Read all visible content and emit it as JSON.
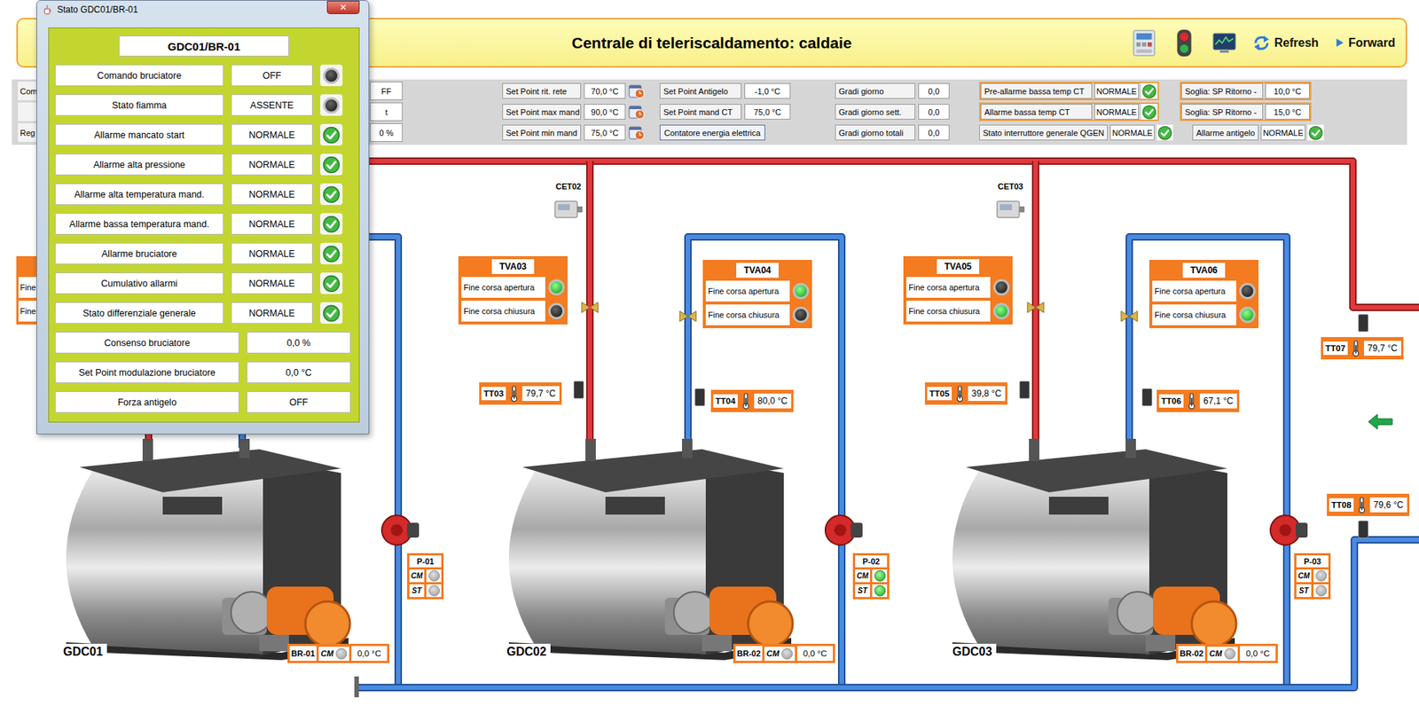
{
  "header": {
    "title": "Centrale di teleriscaldamento: caldaie",
    "buttons": [
      {
        "label": "Refresh"
      },
      {
        "label": "Forward"
      }
    ]
  },
  "parameters": {
    "cut_left": [
      "Com",
      "",
      "Reg"
    ],
    "cut_values": [
      "FF",
      "t",
      "0 %"
    ],
    "setpoints": [
      {
        "label": "Set Point rit. rete",
        "value": "70,0 °C"
      },
      {
        "label": "Set Point max mand",
        "value": "90,0 °C"
      },
      {
        "label": "Set Point min mand",
        "value": "75,0 °C"
      }
    ],
    "ct": [
      {
        "label": "Set Point Antigelo",
        "value": "-1,0 °C"
      },
      {
        "label": "Set Point mand CT",
        "value": "75,0 °C"
      }
    ],
    "energy_button": "Contatore energia elettrica",
    "degree_days": [
      {
        "label": "Gradi giorno",
        "value": "0,0"
      },
      {
        "label": "Gradi giorno sett.",
        "value": "0,0"
      },
      {
        "label": "Gradi giorno totali",
        "value": "0,0"
      }
    ],
    "alarms": [
      {
        "label": "Pre-allarme bassa temp CT",
        "status": "NORMALE",
        "ok": true
      },
      {
        "label": "Allarme bassa temp CT",
        "status": "NORMALE",
        "ok": true
      },
      {
        "label": "Stato interruttore generale QGEN",
        "status": "NORMALE",
        "ok": true
      },
      {
        "label": "Allarme antigelo",
        "status": "NORMALE",
        "ok": true
      }
    ],
    "thresholds": [
      {
        "label": "Soglia: SP Ritorno -",
        "value": "10,0 °C"
      },
      {
        "label": "Soglia: SP Ritorno -",
        "value": "15,0 °C"
      }
    ]
  },
  "dialog": {
    "title": "Stato GDC01/BR-01",
    "close": "✕",
    "heading": "GDC01/BR-01",
    "rows": [
      {
        "label": "Comando bruciatore",
        "value": "OFF",
        "kind": "lamp",
        "on": false
      },
      {
        "label": "Stato fiamma",
        "value": "ASSENTE",
        "kind": "lamp",
        "on": false
      },
      {
        "label": "Allarme mancato start",
        "value": "NORMALE",
        "kind": "check",
        "ok": true
      },
      {
        "label": "Allarme alta pressione",
        "value": "NORMALE",
        "kind": "check",
        "ok": true
      },
      {
        "label": "Allarme alta temperatura mand.",
        "value": "NORMALE",
        "kind": "check",
        "ok": true
      },
      {
        "label": "Allarme bassa temperatura mand.",
        "value": "NORMALE",
        "kind": "check",
        "ok": true
      },
      {
        "label": "Allarme bruciatore",
        "value": "NORMALE",
        "kind": "check",
        "ok": true
      },
      {
        "label": "Cumulativo allarmi",
        "value": "NORMALE",
        "kind": "check",
        "ok": true
      },
      {
        "label": "Stato differenziale generale",
        "value": "NORMALE",
        "kind": "check",
        "ok": true
      },
      {
        "label": "Consenso bruciatore",
        "value": "0,0 %",
        "kind": "value"
      },
      {
        "label": "Set Point modulazione bruciatore",
        "value": "0,0 °C",
        "kind": "value"
      },
      {
        "label": "Forza antigelo",
        "value": "OFF",
        "kind": "value"
      }
    ]
  },
  "plant": {
    "cut_valve": {
      "items": [
        "Fine",
        "Fine"
      ]
    },
    "valves": [
      {
        "name": "TVA03",
        "items": [
          {
            "label": "Fine corsa apertura",
            "on": true
          },
          {
            "label": "Fine corsa chiusura",
            "on": false
          }
        ]
      },
      {
        "name": "TVA04",
        "items": [
          {
            "label": "Fine corsa apertura",
            "on": true
          },
          {
            "label": "Fine corsa chiusura",
            "on": false
          }
        ]
      },
      {
        "name": "TVA05",
        "items": [
          {
            "label": "Fine corsa apertura",
            "on": false
          },
          {
            "label": "Fine corsa chiusura",
            "on": true
          }
        ]
      },
      {
        "name": "TVA06",
        "items": [
          {
            "label": "Fine corsa apertura",
            "on": false
          },
          {
            "label": "Fine corsa chiusura",
            "on": true
          }
        ]
      }
    ],
    "meters": [
      "CET02",
      "CET03"
    ],
    "sensors": [
      {
        "name": "TT03",
        "value": "79,7 °C"
      },
      {
        "name": "TT04",
        "value": "80,0 °C"
      },
      {
        "name": "TT05",
        "value": "39,8 °C"
      },
      {
        "name": "TT06",
        "value": "67,1 °C"
      },
      {
        "name": "TT07",
        "value": "79,7 °C"
      },
      {
        "name": "TT08",
        "value": "79,6 °C"
      }
    ],
    "pumps": [
      {
        "name": "P-01",
        "signals": [
          {
            "label": "CM",
            "on": false
          },
          {
            "label": "ST",
            "on": false
          }
        ]
      },
      {
        "name": "P-02",
        "signals": [
          {
            "label": "CM",
            "on": true
          },
          {
            "label": "ST",
            "on": true
          }
        ]
      },
      {
        "name": "P-03",
        "signals": [
          {
            "label": "CM",
            "on": false
          },
          {
            "label": "ST",
            "on": false
          }
        ]
      }
    ],
    "boilers": [
      {
        "name": "GDC01",
        "burner": {
          "name": "BR-01",
          "signal": {
            "label": "CM",
            "on": false
          },
          "value": "0,0 °C"
        }
      },
      {
        "name": "GDC02",
        "burner": {
          "name": "BR-02",
          "signal": {
            "label": "CM",
            "on": false
          },
          "value": "0,0 °C"
        }
      },
      {
        "name": "GDC03",
        "burner": {
          "name": "BR-02",
          "signal": {
            "label": "CM",
            "on": false
          },
          "value": "0,0 °C"
        }
      }
    ]
  }
}
